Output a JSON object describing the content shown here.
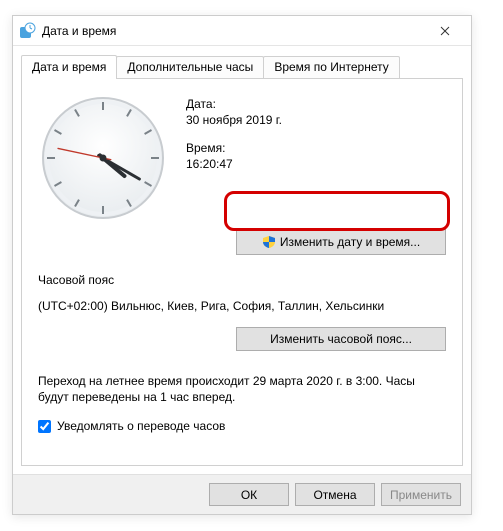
{
  "window": {
    "title": "Дата и время"
  },
  "tabs": {
    "t0": "Дата и время",
    "t1": "Дополнительные часы",
    "t2": "Время по Интернету"
  },
  "date": {
    "label": "Дата:",
    "value": "30 ноября 2019 г."
  },
  "time": {
    "label": "Время:",
    "value": "16:20:47"
  },
  "buttons": {
    "change_datetime": "Изменить дату и время...",
    "change_timezone": "Изменить часовой пояс...",
    "ok": "ОК",
    "cancel": "Отмена",
    "apply": "Применить"
  },
  "timezone": {
    "section_label": "Часовой пояс",
    "text": "(UTC+02:00) Вильнюс, Киев, Рига, София, Таллин, Хельсинки"
  },
  "dst": {
    "text": "Переход на летнее время происходит 29 марта 2020 г. в 3:00. Часы будут переведены на 1 час вперед.",
    "notify_label": "Уведомлять о переводе часов"
  },
  "clock": {
    "hour": 4,
    "minute": 20,
    "second": 47
  }
}
